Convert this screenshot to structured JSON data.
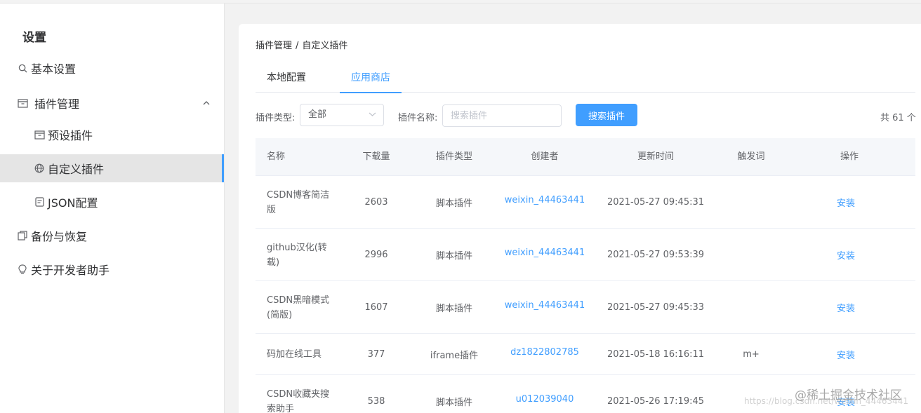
{
  "sidebar": {
    "title": "设置",
    "items": [
      {
        "label": "基本设置",
        "icon": "search-icon"
      },
      {
        "label": "插件管理",
        "icon": "box-icon"
      },
      {
        "label": "预设插件",
        "icon": "box-icon"
      },
      {
        "label": "自定义插件",
        "icon": "globe-icon"
      },
      {
        "label": "JSON配置",
        "icon": "document-icon"
      },
      {
        "label": "备份与恢复",
        "icon": "backup-icon"
      },
      {
        "label": "关于开发者助手",
        "icon": "bulb-icon"
      }
    ]
  },
  "breadcrumb": {
    "parent": "插件管理",
    "sep": "/",
    "current": "自定义插件"
  },
  "tabs": [
    "本地配置",
    "应用商店"
  ],
  "filters": {
    "type_label": "插件类型:",
    "type_value": "全部",
    "name_label": "插件名称:",
    "name_placeholder": "搜索插件",
    "search_button": "搜索插件",
    "total": "共 61 个"
  },
  "table": {
    "headers": [
      "名称",
      "下载量",
      "插件类型",
      "创建者",
      "更新时间",
      "触发词",
      "操作"
    ],
    "rows": [
      {
        "name": "CSDN博客简洁版",
        "downloads": "2603",
        "type": "脚本插件",
        "creator": "weixin_44463441",
        "updated": "2021-05-27 09:45:31",
        "trigger": "",
        "action": "安装"
      },
      {
        "name": "github汉化(转载)",
        "downloads": "2996",
        "type": "脚本插件",
        "creator": "weixin_44463441",
        "updated": "2021-05-27 09:53:39",
        "trigger": "",
        "action": "安装"
      },
      {
        "name": "CSDN黑暗模式(简版)",
        "downloads": "1607",
        "type": "脚本插件",
        "creator": "weixin_44463441",
        "updated": "2021-05-27 09:45:33",
        "trigger": "",
        "action": "安装"
      },
      {
        "name": "码加在线工具",
        "downloads": "377",
        "type": "iframe插件",
        "creator": "dz1822802785",
        "updated": "2021-05-18 16:16:11",
        "trigger": "m+",
        "action": "安装"
      },
      {
        "name": "CSDN收藏夹搜索助手",
        "downloads": "538",
        "type": "脚本插件",
        "creator": "u012039040",
        "updated": "2021-05-26 17:19:45",
        "trigger": "",
        "action": "安装"
      }
    ]
  },
  "watermark": "@稀土掘金技术社区",
  "watermark_url": "https://blog.csdn.net/weixin_44463441"
}
